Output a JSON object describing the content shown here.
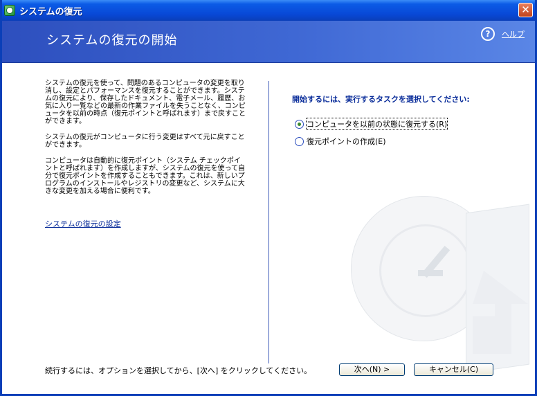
{
  "window": {
    "title": "システムの復元",
    "close_glyph": "✕"
  },
  "header": {
    "title": "システムの復元の開始",
    "help_label": "ヘルプ",
    "help_glyph": "?"
  },
  "left_panel": {
    "paragraphs": [
      "システムの復元を使って、問題のあるコンピュータの変更を取り消し、設定とパフォーマンスを復元することができます。システムの復元により、保存したドキュメント、電子メール、履歴、お気に入り一覧などの最新の作業ファイルを失うことなく、コンピュータを以前の時点（復元ポイントと呼ばれます）まで戻すことができます。",
      "システムの復元がコンピュータに行う変更はすべて元に戻すことができます。",
      "コンピュータは自動的に復元ポイント（システム チェックポイントと呼ばれます）を作成しますが、システムの復元を使って自分で復元ポイントを作成することもできます。これは、新しいプログラムのインストールやレジストリの変更など、システムに大きな変更を加える場合に便利です。"
    ],
    "settings_link": "システムの復元の設定"
  },
  "right_panel": {
    "prompt": "開始するには、実行するタスクを選択してください:",
    "options": [
      {
        "label": "コンピュータを以前の状態に復元する(R)",
        "selected": true
      },
      {
        "label": "復元ポイントの作成(E)",
        "selected": false
      }
    ]
  },
  "footer": {
    "instruction": "続行するには、オプションを選択してから、[次へ] をクリックしてください。",
    "next_label": "次へ(N) >",
    "cancel_label": "キャンセル(C)"
  },
  "colors": {
    "titlebar": "#0848d6",
    "header": "#3f68d4",
    "link": "#0a2d9a",
    "divider": "#3d5ab8"
  }
}
